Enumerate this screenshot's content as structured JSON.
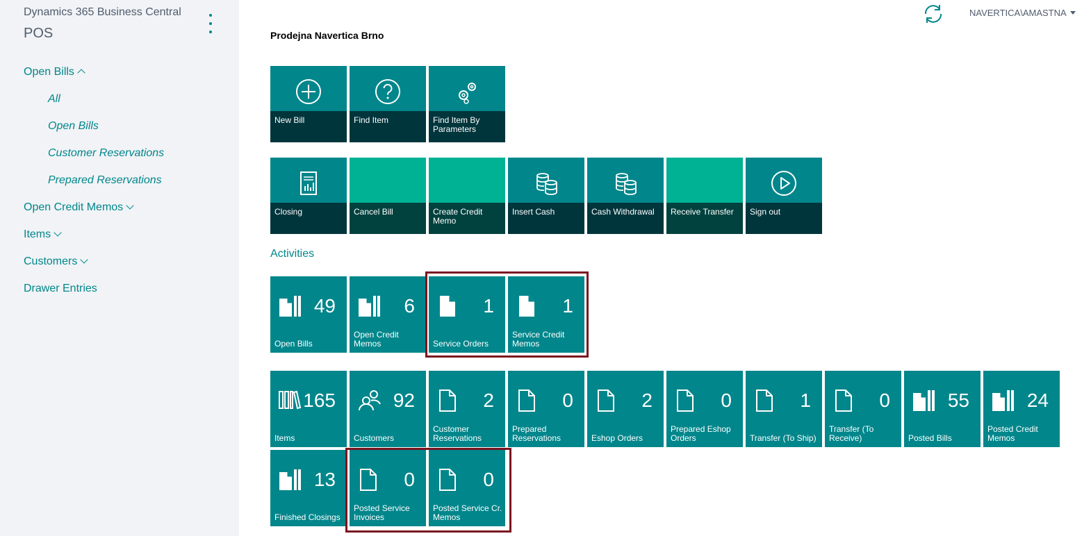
{
  "app": {
    "title": "Dynamics 365 Business Central",
    "role": "POS"
  },
  "user": {
    "name": "NAVERTICA\\AMASTNA"
  },
  "sidebar": {
    "items": [
      {
        "label": "Open Bills"
      },
      {
        "label": "All"
      },
      {
        "label": "Open Bills"
      },
      {
        "label": "Customer Reservations"
      },
      {
        "label": "Prepared Reservations"
      },
      {
        "label": "Open Credit Memos"
      },
      {
        "label": "Items"
      },
      {
        "label": "Customers"
      },
      {
        "label": "Drawer Entries"
      }
    ]
  },
  "main": {
    "page_title": "Prodejna Navertica Brno",
    "actions_row1": [
      {
        "label": "New Bill",
        "icon": "plus-circle-icon"
      },
      {
        "label": "Find Item",
        "icon": "question-circle-icon"
      },
      {
        "label": "Find Item By Parameters",
        "icon": "gears-icon"
      }
    ],
    "actions_row2": [
      {
        "label": "Closing",
        "icon": "report-icon"
      },
      {
        "label": "Cancel Bill",
        "icon": ""
      },
      {
        "label": "Create Credit Memo",
        "icon": ""
      },
      {
        "label": "Insert Cash",
        "icon": "coins-icon"
      },
      {
        "label": "Cash Withdrawal",
        "icon": "coins-icon"
      },
      {
        "label": "Receive Transfer",
        "icon": ""
      },
      {
        "label": "Sign out",
        "icon": "play-circle-icon"
      }
    ],
    "activities_title": "Activities",
    "cues_row1": [
      {
        "label": "Open Bills",
        "value": "49",
        "icon": "documents-icon"
      },
      {
        "label": "Open Credit Memos",
        "value": "6",
        "icon": "documents-icon"
      },
      {
        "label": "Service Orders",
        "value": "1",
        "icon": "document-icon"
      },
      {
        "label": "Service Credit Memos",
        "value": "1",
        "icon": "document-icon"
      }
    ],
    "cues_row2": [
      {
        "label": "Items",
        "value": "165",
        "icon": "books-icon"
      },
      {
        "label": "Customers",
        "value": "92",
        "icon": "people-icon"
      },
      {
        "label": "Customer Reservations",
        "value": "2",
        "icon": "document-icon"
      },
      {
        "label": "Prepared Reservations",
        "value": "0",
        "icon": "document-icon"
      },
      {
        "label": "Eshop Orders",
        "value": "2",
        "icon": "document-icon"
      },
      {
        "label": "Prepared Eshop Orders",
        "value": "0",
        "icon": "document-icon"
      },
      {
        "label": "Transfer (To Ship)",
        "value": "1",
        "icon": "document-icon"
      },
      {
        "label": "Transfer (To Receive)",
        "value": "0",
        "icon": "document-icon"
      },
      {
        "label": "Posted Bills",
        "value": "55",
        "icon": "documents-icon"
      },
      {
        "label": "Posted Credit Memos",
        "value": "24",
        "icon": "documents-icon"
      }
    ],
    "cues_row3": [
      {
        "label": "Finished Closings",
        "value": "13",
        "icon": "documents-icon"
      },
      {
        "label": "Posted Service Invoices",
        "value": "0",
        "icon": "document-icon"
      },
      {
        "label": "Posted Service Cr. Memos",
        "value": "0",
        "icon": "document-icon"
      }
    ]
  },
  "colors": {
    "tile": "#00868b",
    "tile_band": "#00353c",
    "tile_green": "#00b294",
    "highlight": "#7b1520",
    "sidebar_bg": "#f1f3f6"
  }
}
